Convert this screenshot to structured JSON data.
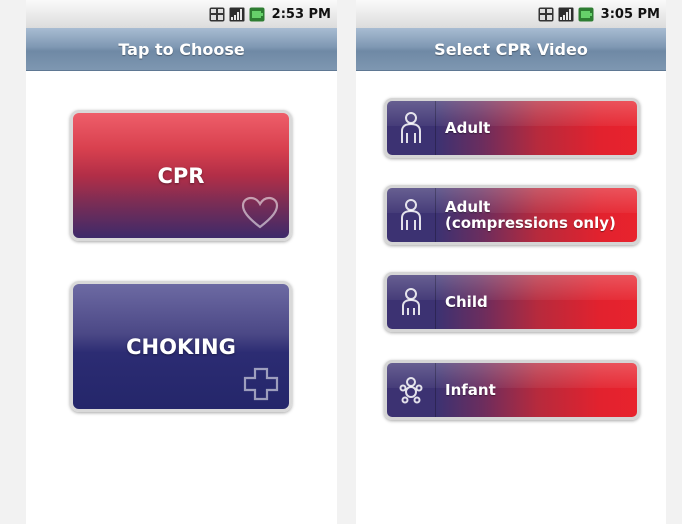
{
  "left_screen": {
    "status": {
      "time": "2:53 PM",
      "icons": [
        "network-3g-icon",
        "signal-bars-icon",
        "battery-icon"
      ]
    },
    "title": "Tap to Choose",
    "buttons": [
      {
        "label": "CPR",
        "icon": "heart-icon"
      },
      {
        "label": "CHOKING",
        "icon": "plus-cross-icon"
      }
    ]
  },
  "right_screen": {
    "status": {
      "time": "3:05 PM",
      "icons": [
        "network-3g-icon",
        "signal-bars-icon",
        "battery-icon"
      ]
    },
    "title": "Select CPR Video",
    "items": [
      {
        "label": "Adult",
        "sublabel": "",
        "icon": "adult-figure-icon"
      },
      {
        "label": "Adult",
        "sublabel": "(compressions only)",
        "icon": "adult-figure-icon"
      },
      {
        "label": "Child",
        "sublabel": "",
        "icon": "child-figure-icon"
      },
      {
        "label": "Infant",
        "sublabel": "",
        "icon": "infant-figure-icon"
      }
    ]
  },
  "colors": {
    "title_bar": "#7f98b3",
    "cpr_red": "#d9414f",
    "choking_blue": "#2c2c73",
    "video_red": "#e2222e",
    "video_purple": "#3c3272"
  }
}
